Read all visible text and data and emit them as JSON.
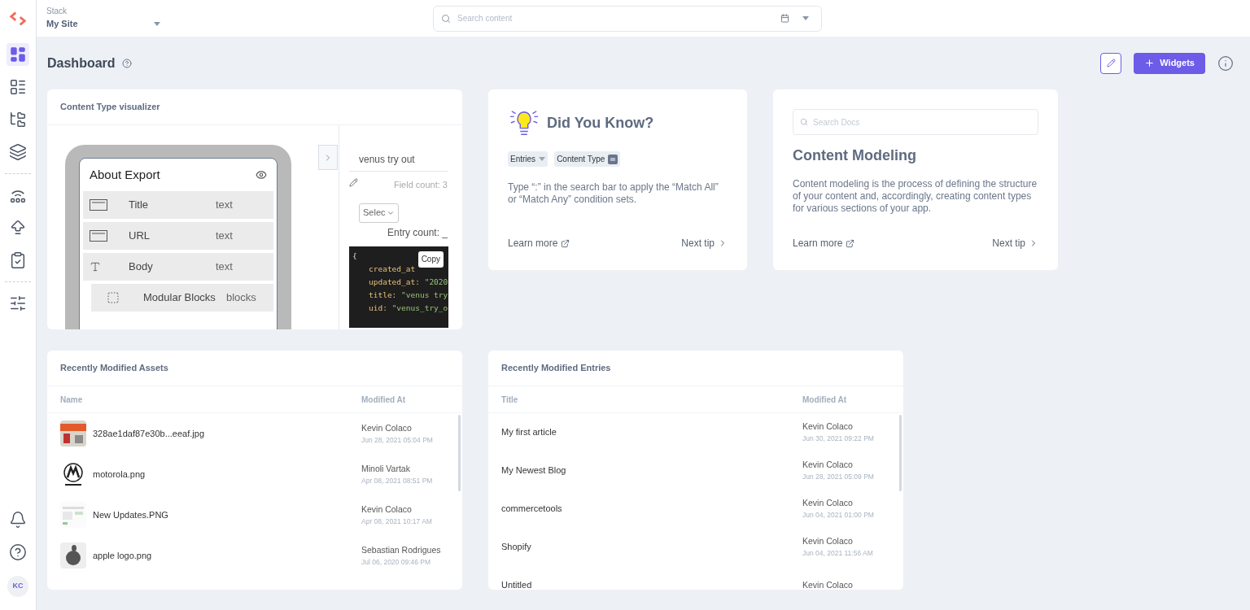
{
  "stack": {
    "label": "Stack",
    "name": "My Site"
  },
  "search": {
    "placeholder": "Search content"
  },
  "sidebar": {
    "items": [
      {
        "kind": "dashboard",
        "selected": true
      },
      {
        "kind": "entries",
        "selected": false
      },
      {
        "kind": "tree",
        "selected": false
      },
      {
        "kind": "layers",
        "selected": false,
        "divider_after": true
      },
      {
        "kind": "signal",
        "selected": false
      },
      {
        "kind": "deploy",
        "selected": false
      },
      {
        "kind": "tasks",
        "selected": false,
        "divider_after": true
      },
      {
        "kind": "settings",
        "selected": false
      }
    ],
    "avatar": "KC"
  },
  "page": {
    "title": "Dashboard",
    "widgets_button": "Widgets"
  },
  "visualizer": {
    "title": "Content Type visualizer",
    "model": {
      "title": "About Export",
      "fields": [
        {
          "kind": "line",
          "name": "Title",
          "type": "text"
        },
        {
          "kind": "line",
          "name": "URL",
          "type": "text"
        },
        {
          "kind": "rich",
          "name": "Body",
          "type": "text"
        },
        {
          "kind": "blocks",
          "name": "Modular Blocks",
          "type": "blocks"
        }
      ]
    },
    "entry": {
      "name": "venus try out",
      "field_count": "Field count: 3",
      "select": "Selec",
      "entry_count": "Entry count: _",
      "copy": "Copy",
      "brace": "{",
      "code": [
        {
          "key": "created_at"
        },
        {
          "key": "updated_at:",
          "value": "\"2020"
        },
        {
          "key": "title:",
          "value": "\"venus try"
        },
        {
          "key": "uid:",
          "value": "\"venus_try_o"
        }
      ]
    }
  },
  "tip": {
    "title": "Did You Know?",
    "chips": [
      "Entries",
      "Content Type"
    ],
    "text": "Type “:” in the search bar to apply the “Match All” or “Match Any” condition sets.",
    "learn_more": "Learn more",
    "next": "Next tip"
  },
  "modeling": {
    "search_placeholder": "Search Docs",
    "title": "Content Modeling",
    "text": "Content modeling is the process of defining the structure of your content and, accordingly, creating content types for various sections of your app.",
    "learn_more": "Learn more",
    "next": "Next tip"
  },
  "assets": {
    "title": "Recently Modified Assets",
    "columns": [
      "Name",
      "Modified At"
    ],
    "rows": [
      {
        "name": "328ae1daf87e30b...eeaf.jpg",
        "user": "Kevin Colaco",
        "date": "Jun 28, 2021 05:04 PM"
      },
      {
        "name": "motorola.png",
        "user": "Minoli Vartak",
        "date": "Apr 08, 2021 08:51 PM"
      },
      {
        "name": "New Updates.PNG",
        "user": "Kevin Colaco",
        "date": "Apr 08, 2021 10:17 AM"
      },
      {
        "name": "apple logo.png",
        "user": "Sebastian Rodrigues",
        "date": "Jul 06, 2020 09:46 PM"
      }
    ]
  },
  "entries": {
    "title": "Recently Modified Entries",
    "columns": [
      "Title",
      "Modified At"
    ],
    "rows": [
      {
        "name": "My first article",
        "user": "Kevin Colaco",
        "date": "Jun 30, 2021 09:22 PM"
      },
      {
        "name": "My Newest Blog",
        "user": "Kevin Colaco",
        "date": "Jun 28, 2021 05:09 PM"
      },
      {
        "name": "commercetools",
        "user": "Kevin Colaco",
        "date": "Jun 04, 2021 01:00 PM"
      },
      {
        "name": "Shopify",
        "user": "Kevin Colaco",
        "date": "Jun 04, 2021 11:56 AM"
      },
      {
        "name": "Untitled",
        "user": "Kevin Colaco"
      }
    ]
  }
}
